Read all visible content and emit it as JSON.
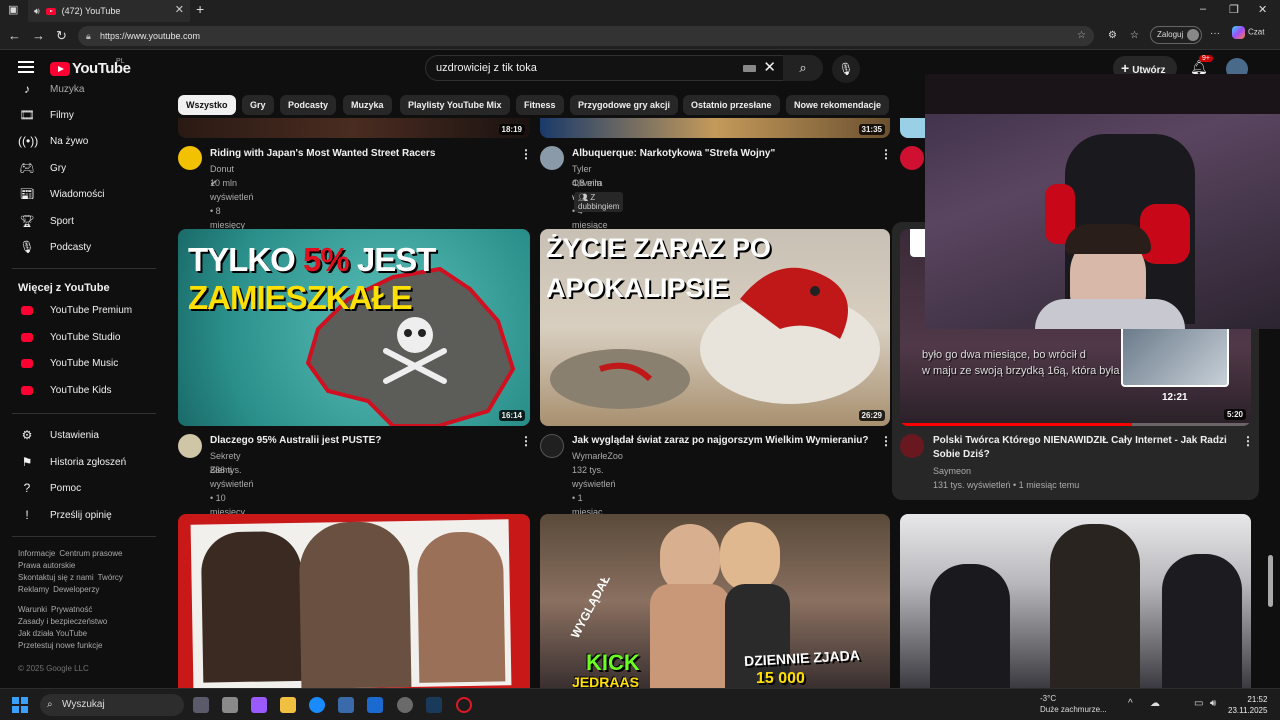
{
  "browser": {
    "tab_title": "(472) YouTube",
    "url": "https://www.youtube.com",
    "signin_label": "Zaloguj",
    "copilot_label": "Czat"
  },
  "header": {
    "logo_text": "YouTube",
    "region": "PL",
    "search_value": "uzdrowiciej z  tik toka",
    "create_label": "Utwórz",
    "notif_count": "9+"
  },
  "sidebar": {
    "top_items": [
      {
        "label": "Muzyka",
        "icon": "music-icon"
      },
      {
        "label": "Filmy",
        "icon": "film-icon"
      },
      {
        "label": "Na żywo",
        "icon": "live-icon"
      },
      {
        "label": "Gry",
        "icon": "gamepad-icon"
      },
      {
        "label": "Wiadomości",
        "icon": "news-icon"
      },
      {
        "label": "Sport",
        "icon": "trophy-icon"
      },
      {
        "label": "Podcasty",
        "icon": "podcast-icon"
      }
    ],
    "more_header": "Więcej z YouTube",
    "more_items": [
      {
        "label": "YouTube Premium"
      },
      {
        "label": "YouTube Studio"
      },
      {
        "label": "YouTube Music"
      },
      {
        "label": "YouTube Kids"
      }
    ],
    "settings_items": [
      {
        "label": "Ustawienia",
        "icon": "gear-icon"
      },
      {
        "label": "Historia zgłoszeń",
        "icon": "flag-icon"
      },
      {
        "label": "Pomoc",
        "icon": "help-icon"
      },
      {
        "label": "Prześlij opinię",
        "icon": "feedback-icon"
      }
    ],
    "footer_lines": [
      [
        "Informacje",
        "Centrum prasowe"
      ],
      [
        "Prawa autorskie"
      ],
      [
        "Skontaktuj się z nami",
        "Twórcy"
      ],
      [
        "Reklamy",
        "Deweloperzy"
      ]
    ],
    "footer_lines2": [
      [
        "Warunki",
        "Prywatność"
      ],
      [
        "Zasady i bezpieczeństwo"
      ],
      [
        "Jak działa YouTube"
      ],
      [
        "Przetestuj nowe funkcje"
      ]
    ],
    "copyright": "© 2025 Google LLC"
  },
  "chips": [
    "Wszystko",
    "Gry",
    "Podcasty",
    "Muzyka",
    "Playlisty YouTube Mix",
    "Fitness",
    "Przygodowe gry akcji",
    "Ostatnio przesłane",
    "Nowe rekomendacje"
  ],
  "videos_row1": [
    {
      "duration": "18:19",
      "title": "Riding with Japan's Most Wanted Street Racers",
      "channel": "Donut ✔",
      "meta": "10 mln wyświetleń • 8 miesięcy temu"
    },
    {
      "duration": "31:35",
      "title": "Albuquerque: Narkotykowa \"Strefa Wojny\"",
      "channel": "Tyler Oliveira ✔",
      "meta": "4,8 mln wyświetleń • 4 miesiące temu",
      "badge": "Z dubbingiem"
    }
  ],
  "videos_row2": [
    {
      "duration": "16:14",
      "title": "Dlaczego 95% Australii jest PUSTE?",
      "channel": "Sekrety Ziemi",
      "meta": "886 tys. wyświetleń • 10 miesięcy temu",
      "thumb_text1": "TYLKO ",
      "thumb_text2": "5%",
      "thumb_text3": " JEST",
      "thumb_text4": "ZAMIESZKAŁE"
    },
    {
      "duration": "26:29",
      "title": "Jak wyglądał świat zaraz po najgorszym Wielkim Wymieraniu?",
      "channel": "WymarłeZoo",
      "meta": "132 tys. wyświetleń • 1 miesiąc temu",
      "thumb_text1": "ŻYCIE ZARAZ PO",
      "thumb_text2": "APOKALIPSIE"
    },
    {
      "duration": "5:20",
      "title": "Polski Twórca Którego NIENAWIDZIŁ Cały Internet - Jak Radzi Sobie Dziś?",
      "channel": "Saymeon",
      "meta": "131 tys. wyświetleń • 1 miesiąc temu",
      "subtitle1": "było go dwa miesiące, bo wrócił d",
      "subtitle2": "w maju ze swoją brzydką 16ą, która była",
      "hover_time": "12:21",
      "progress_fraction": 0.66
    }
  ],
  "row3_thumb_texts": {
    "kick": "KICK",
    "name": "JEDRAAS",
    "side": "WYGLĄDAŁ",
    "zjada": "DZIENNIE ZJADA",
    "amount": "15 000"
  },
  "taskbar": {
    "search_placeholder": "Wyszukaj",
    "temp": "-3°C",
    "weather": "Duże zachmurze...",
    "time": "21:52",
    "date": "23.11.2025"
  }
}
